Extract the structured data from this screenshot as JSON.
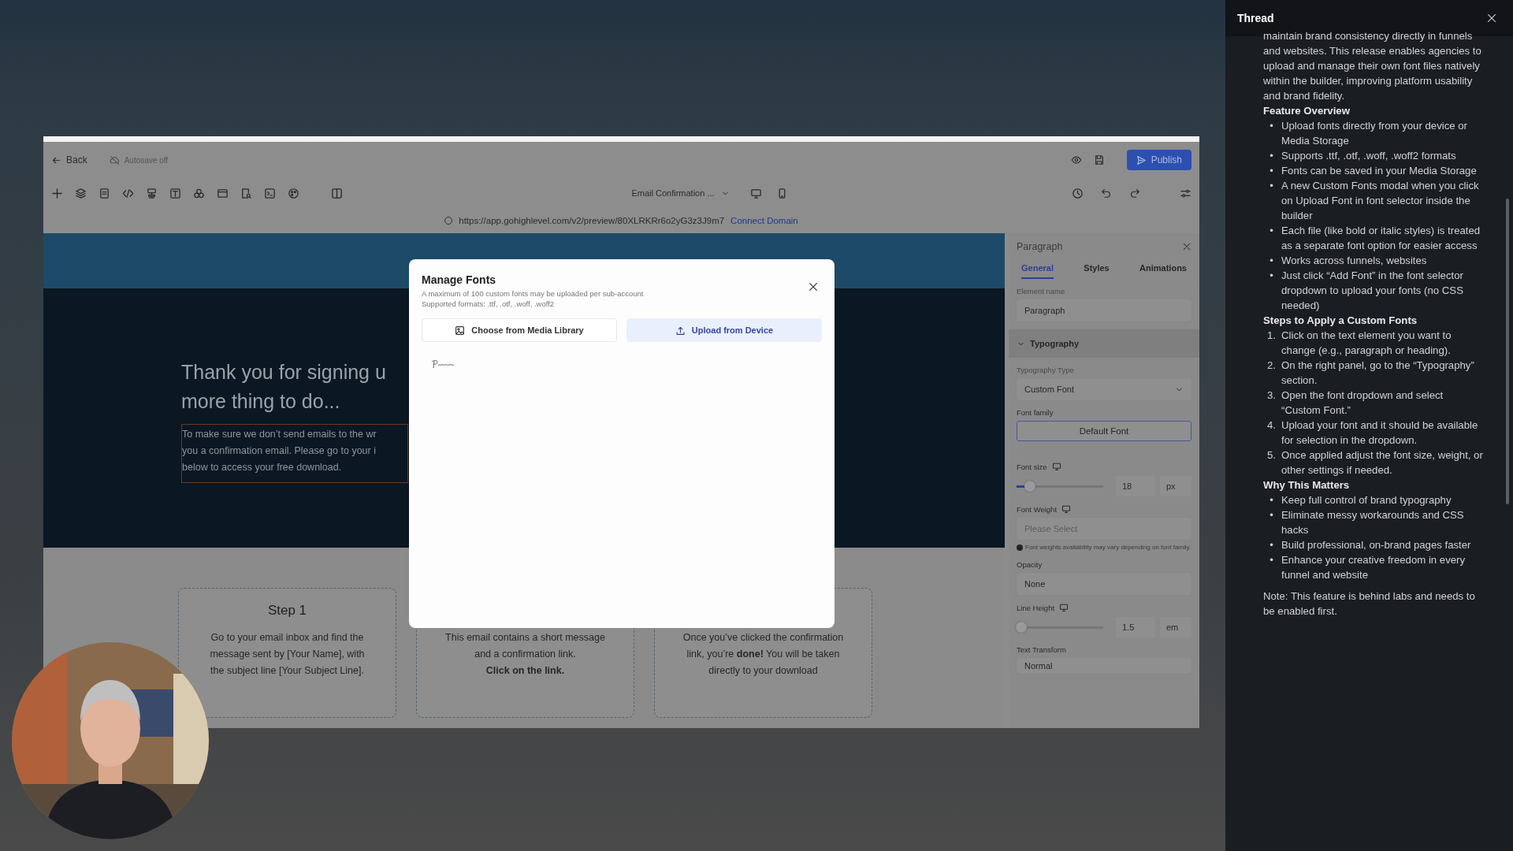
{
  "builder": {
    "top_bar": {
      "back": "Back",
      "autosave": "Autosave off",
      "publish": "Publish"
    },
    "toolbar": {
      "page_select": "Email Confirmation ..."
    },
    "url_bar": {
      "url": "https://app.gohighlevel.com/v2/preview/80XLRKRr6o2yG3z3J9m7",
      "connect_domain": "Connect Domain"
    }
  },
  "canvas": {
    "heading_lines": [
      "Thank you for signing u",
      "more thing to do..."
    ],
    "paragraph_lines": [
      "To make sure we don’t send emails to the wr",
      "you a confirmation email. Please go to your i",
      "below to access your free download."
    ],
    "steps": [
      {
        "title": "Step 1",
        "lines": [
          "Go to your email inbox and find the",
          "message sent by [Your Name], with",
          "the subject line [Your Subject Line]."
        ]
      },
      {
        "lines": [
          "This email contains a short message",
          "and a confirmation link.",
          "**Click on the link.**"
        ]
      },
      {
        "lines": [
          "Once you’ve clicked the confirmation",
          "link, you’re **done!** You will be taken",
          "directly to your download"
        ]
      }
    ]
  },
  "modal": {
    "title": "Manage Fonts",
    "subtitle_lines": [
      "A maximum of 100 custom fonts may be uploaded per sub-account",
      "Supported formats: .ttf, .otf, .woff, .woff2"
    ],
    "buttons": [
      {
        "label": "Choose from Media Library",
        "selected": false
      },
      {
        "label": "Upload from Device",
        "selected": true
      }
    ]
  },
  "panel": {
    "title": "Paragraph",
    "tabs": [
      {
        "label": "General",
        "selected": true
      },
      {
        "label": "Styles",
        "selected": false
      },
      {
        "label": "Animations",
        "selected": false
      }
    ],
    "element_name": {
      "label": "Element name",
      "value": "Paragraph"
    },
    "section": {
      "title": "Typography",
      "expanded": true
    },
    "typography_type": {
      "label": "Typography Type",
      "value": "Custom Font"
    },
    "font_family": {
      "label": "Font family",
      "value": "Default Font"
    },
    "font_size": {
      "label": "Font size",
      "level": 0.15,
      "value": "18",
      "unit": "px"
    },
    "font_weight": {
      "label": "Font Weight",
      "placeholder": "Please Select",
      "note": "Font weights availability may vary depending on font family."
    },
    "opacity": {
      "label": "Opacity",
      "value": "None"
    },
    "line_height": {
      "label": "Line Height",
      "level": 0.05,
      "value": "1.5",
      "unit": "em"
    },
    "text_transform": {
      "label": "Text Transform",
      "value": "Normal"
    }
  },
  "thread": {
    "title": "Thread",
    "blocks": [
      {
        "kind": "paragraph",
        "text": "maintain brand consistency directly in funnels and websites. This release enables agencies to upload and manage their own font files natively within the builder, improving platform usability and brand fidelity."
      },
      {
        "kind": "heading",
        "text": "Feature Overview"
      },
      {
        "kind": "list",
        "items": [
          {
            "marker": "•",
            "text": "Upload fonts directly from your device or Media Storage"
          },
          {
            "marker": "•",
            "text": "Supports .ttf, .otf, .woff, .woff2 formats"
          },
          {
            "marker": "•",
            "text": "Fonts can be saved in your Media Storage"
          },
          {
            "marker": "•",
            "text": "A new Custom Fonts modal when you click on Upload Font in font selector inside the builder"
          },
          {
            "marker": "•",
            "text": "Each file (like bold or italic styles) is treated as a separate font option for easier access"
          },
          {
            "marker": "•",
            "text": "Works across funnels, websites"
          },
          {
            "marker": "•",
            "text": "Just click “Add Font” in the font selector dropdown to upload your fonts (no CSS needed)"
          }
        ]
      },
      {
        "kind": "heading",
        "text": "Steps to Apply a Custom Fonts"
      },
      {
        "kind": "list",
        "items": [
          {
            "marker": "1.",
            "text": "Click on the text element you want to change (e.g., paragraph or heading)."
          },
          {
            "marker": "2.",
            "text": "On the right panel, go to the “Typography” section."
          },
          {
            "marker": "3.",
            "text": "Open the font dropdown and select “Custom Font.”"
          },
          {
            "marker": "4.",
            "text": "Upload your font and it should be available for selection in the dropdown."
          },
          {
            "marker": "5.",
            "text": "Once applied adjust the font size, weight, or other settings if needed."
          }
        ]
      },
      {
        "kind": "heading",
        "text": "Why This Matters"
      },
      {
        "kind": "list",
        "items": [
          {
            "marker": "•",
            "text": "Keep full control of brand typography"
          },
          {
            "marker": "•",
            "text": "Eliminate messy workarounds and CSS hacks"
          },
          {
            "marker": "•",
            "text": "Build professional, on-brand pages faster"
          },
          {
            "marker": "•",
            "text": "Enhance your creative freedom in every funnel and website"
          }
        ]
      },
      {
        "kind": "note",
        "text": "Note: This feature is behind labs and needs to be enabled first."
      }
    ]
  }
}
